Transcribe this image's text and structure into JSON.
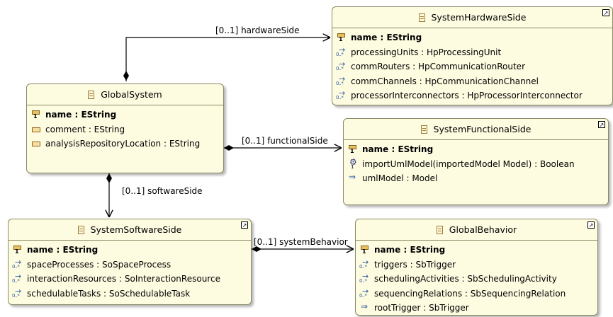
{
  "classes": {
    "global_system": {
      "name": "GlobalSystem",
      "rows": [
        {
          "text": "name : EString",
          "icon": "key-icon",
          "bold": true
        },
        {
          "text": "comment : EString",
          "icon": "attribute-icon",
          "bold": false
        },
        {
          "text": "analysisRepositoryLocation : EString",
          "icon": "attribute-icon",
          "bold": false
        }
      ]
    },
    "system_hardware_side": {
      "name": "SystemHardwareSide",
      "rows": [
        {
          "text": "name : EString",
          "icon": "key-icon",
          "bold": true
        },
        {
          "text": "processingUnits : HpProcessingUnit",
          "icon": "reference-many-icon",
          "bold": false
        },
        {
          "text": "commRouters : HpCommunicationRouter",
          "icon": "reference-many-icon",
          "bold": false
        },
        {
          "text": "commChannels : HpCommunicationChannel",
          "icon": "reference-many-icon",
          "bold": false
        },
        {
          "text": "processorInterconnectors : HpProcessorInterconnector",
          "icon": "reference-many-icon",
          "bold": false
        }
      ]
    },
    "system_functional_side": {
      "name": "SystemFunctionalSide",
      "rows": [
        {
          "text": "name : EString",
          "icon": "key-icon",
          "bold": true
        },
        {
          "text": "importUmlModel(importedModel Model) : Boolean",
          "icon": "operation-icon",
          "bold": false
        },
        {
          "text": "umlModel : Model",
          "icon": "reference-icon",
          "bold": false
        }
      ]
    },
    "system_software_side": {
      "name": "SystemSoftwareSide",
      "rows": [
        {
          "text": "name : EString",
          "icon": "key-icon",
          "bold": true
        },
        {
          "text": "spaceProcesses : SoSpaceProcess",
          "icon": "reference-many-icon",
          "bold": false
        },
        {
          "text": "interactionResources : SoInteractionResource",
          "icon": "reference-many-icon",
          "bold": false
        },
        {
          "text": "schedulableTasks : SoSchedulableTask",
          "icon": "reference-many-icon",
          "bold": false
        }
      ]
    },
    "global_behavior": {
      "name": "GlobalBehavior",
      "rows": [
        {
          "text": "name : EString",
          "icon": "key-icon",
          "bold": true
        },
        {
          "text": "triggers : SbTrigger",
          "icon": "reference-many-icon",
          "bold": false
        },
        {
          "text": "schedulingActivities : SbSchedulingActivity",
          "icon": "reference-many-icon",
          "bold": false
        },
        {
          "text": "sequencingRelations : SbSequencingRelation",
          "icon": "reference-many-icon",
          "bold": false
        },
        {
          "text": "rootTrigger : SbTrigger",
          "icon": "reference-icon",
          "bold": false
        }
      ]
    }
  },
  "edges": {
    "hardware": "[0..1] hardwareSide",
    "functional": "[0..1] functionalSide",
    "software": "[0..1] softwareSide",
    "behavior": "[0..1] systemBehavior"
  }
}
